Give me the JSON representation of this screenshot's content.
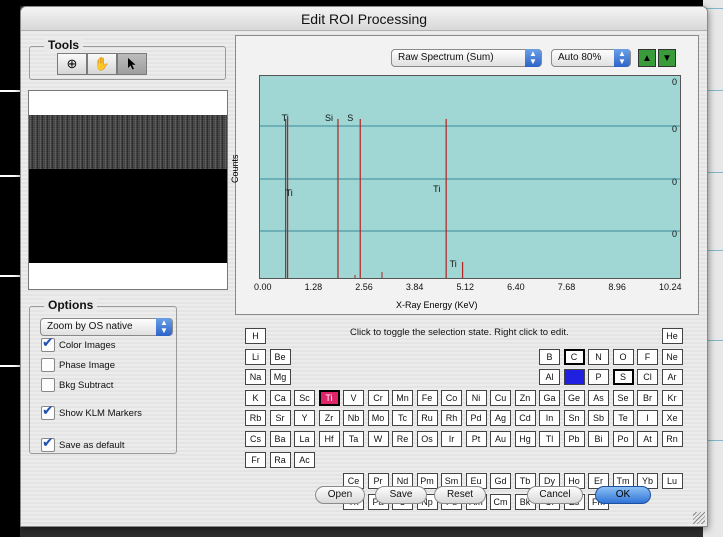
{
  "window": {
    "title": "Edit ROI Processing"
  },
  "tools": {
    "title": "Tools",
    "buttons": [
      {
        "icon": "zoom-icon",
        "glyph": "⊕"
      },
      {
        "icon": "hand-icon",
        "glyph": "✋"
      },
      {
        "icon": "arrow-pointer-icon",
        "glyph": "➤"
      }
    ]
  },
  "options": {
    "title": "Options",
    "zoom_select": "Zoom by OS native",
    "checkboxes": [
      {
        "label": "Color Images",
        "checked": true
      },
      {
        "label": "Phase Image",
        "checked": false
      },
      {
        "label": "Bkg Subtract",
        "checked": false
      },
      {
        "label": "Show KLM Markers",
        "checked": true
      },
      {
        "label": "Save as default",
        "checked": true
      }
    ]
  },
  "spectrum": {
    "mode_select": "Raw Spectrum (Sum)",
    "scale_select": "Auto 80%",
    "ylabel": "Counts",
    "xlabel": "X-Ray Energy (KeV)",
    "xticks": [
      "0.00",
      "1.28",
      "2.56",
      "3.84",
      "5.12",
      "6.40",
      "7.68",
      "8.96",
      "10.24"
    ],
    "right_labels": [
      "0",
      "0",
      "0",
      "0"
    ],
    "markers": [
      {
        "label": "Ti",
        "energy": 0.4
      },
      {
        "label": "Ti",
        "energy": 0.45
      },
      {
        "label": "Si",
        "energy": 1.74
      },
      {
        "label": "S",
        "energy": 2.31
      },
      {
        "label": "Ti",
        "energy": 4.51
      },
      {
        "label": "Ti",
        "energy": 4.93
      }
    ],
    "marker_color": "#b22222",
    "plot_bg": "#a0d6d4"
  },
  "periodic_table": {
    "hint": "Click to toggle the selection state. Right click to edit.",
    "selected_pink": "Ti",
    "selected_blue": "Si",
    "bold": [
      "C",
      "S"
    ]
  },
  "buttons": {
    "open": "Open",
    "save": "Save",
    "reset": "Reset",
    "cancel": "Cancel",
    "ok": "OK"
  }
}
